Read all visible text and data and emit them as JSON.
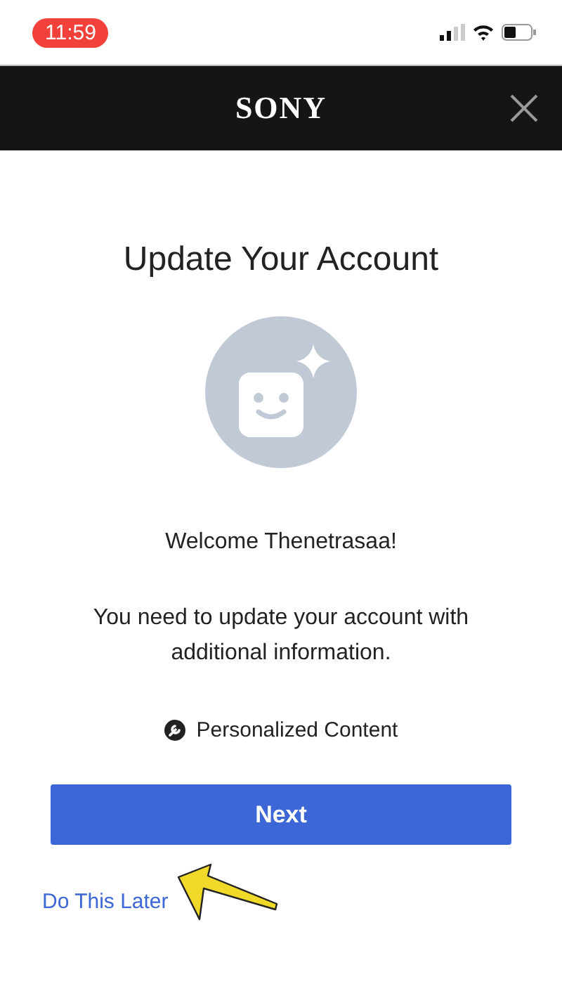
{
  "status_bar": {
    "time": "11:59"
  },
  "header": {
    "logo": "SONY"
  },
  "title": "Update Your Account",
  "welcome": "Welcome Thenetrasaa!",
  "message": "You need to update your account with additional information.",
  "features": [
    {
      "label": "Personalized Content"
    }
  ],
  "primary_button": "Next",
  "later_link": "Do This Later"
}
